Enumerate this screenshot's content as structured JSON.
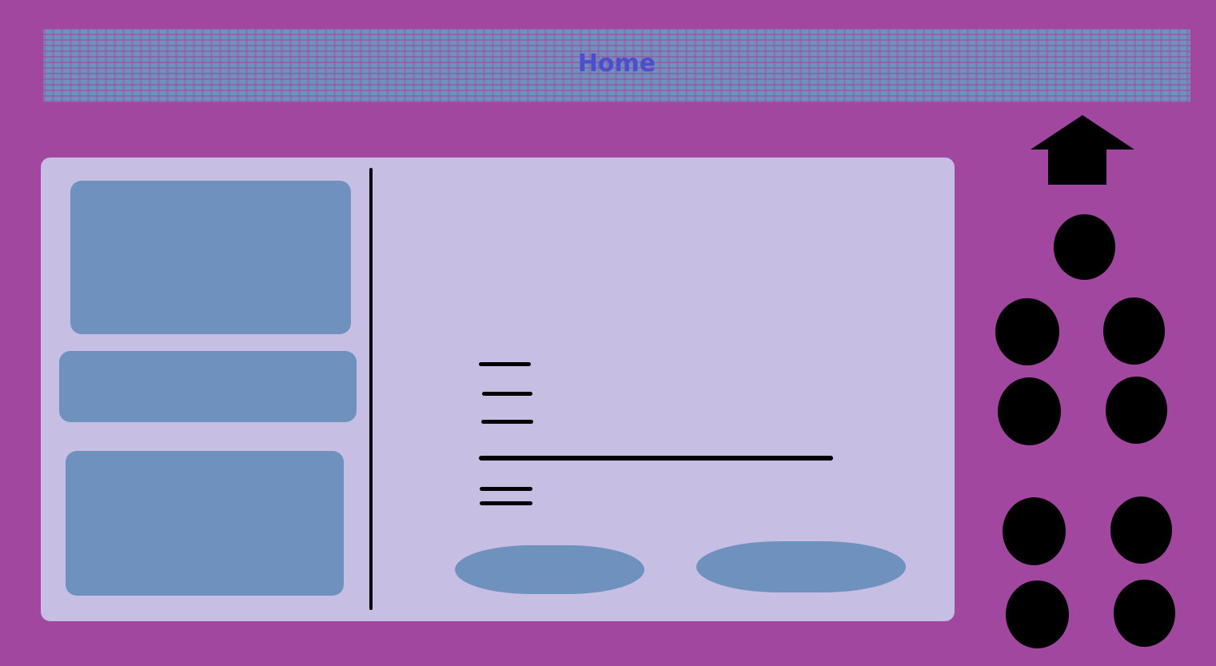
{
  "header": {
    "title": "Home"
  },
  "icons": {
    "home": "home-icon",
    "dot": "circle-button"
  },
  "colors": {
    "background": "#a2479f",
    "panel": "#c6bee3",
    "card": "#6f91be",
    "title": "#4b4fcf"
  }
}
